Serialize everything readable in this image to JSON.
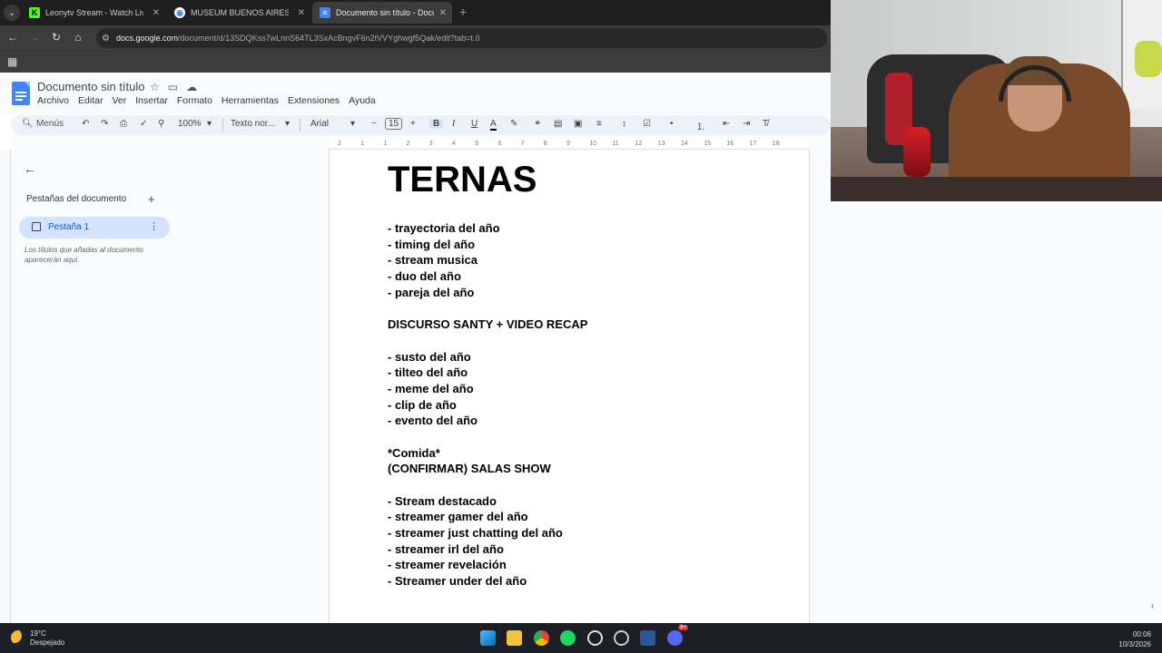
{
  "browser": {
    "tabs": [
      {
        "title": "Leonytv Stream - Watch Live on",
        "favicon": "kick-icon",
        "active": false
      },
      {
        "title": "MUSEUM BUENOS AIRES VACIO",
        "favicon": "chrome-icon",
        "active": false
      },
      {
        "title": "Documento sin título - Docume",
        "favicon": "docs-icon",
        "active": true
      }
    ],
    "new_tab": "+",
    "url_host": "docs.google.com",
    "url_path": "/document/d/13SDQKss7wLnnS64TL3SxAcBngvF6n2tVVYghwgf5Qak/edit?tab=t.0"
  },
  "docs": {
    "title": "Documento sin título",
    "menu": [
      "Archivo",
      "Editar",
      "Ver",
      "Insertar",
      "Formato",
      "Herramientas",
      "Extensiones",
      "Ayuda"
    ],
    "toolbar": {
      "search": "Menús",
      "zoom": "100%",
      "style": "Texto nor...",
      "font": "Arial",
      "font_size": "15",
      "bold": "B",
      "italic": "I",
      "underline": "U",
      "text_color": "A"
    },
    "ruler_ticks": [
      "2",
      "1",
      "1",
      "2",
      "3",
      "4",
      "5",
      "6",
      "7",
      "8",
      "9",
      "10",
      "11",
      "12",
      "13",
      "14",
      "15",
      "16",
      "17",
      "18"
    ],
    "outline": {
      "heading": "Pestañas del documento",
      "tab_label": "Pestaña 1",
      "hint": "Los títulos que añadas al documento aparecerán aquí."
    },
    "content": {
      "title": "TERNAS",
      "lines": [
        "- trayectoria del año",
        "- timing del año",
        "- stream musica",
        "- duo del año",
        "- pareja del año",
        "",
        "DISCURSO SANTY + VIDEO RECAP",
        "",
        "- susto del año",
        "- tilteo del año",
        "- meme del año",
        "- clip de año",
        "- evento del año",
        "",
        "*Comida*",
        "(CONFIRMAR) SALAS SHOW",
        "",
        "- Stream destacado",
        "- streamer gamer del año",
        "- streamer just chatting del año",
        "- streamer irl del año",
        "- streamer revelación",
        "- Streamer under del año"
      ]
    }
  },
  "taskbar": {
    "temperature": "19°C",
    "condition": "Despejado",
    "time": "00:06",
    "date": "10/3/2026",
    "discord_badge": "9+"
  }
}
